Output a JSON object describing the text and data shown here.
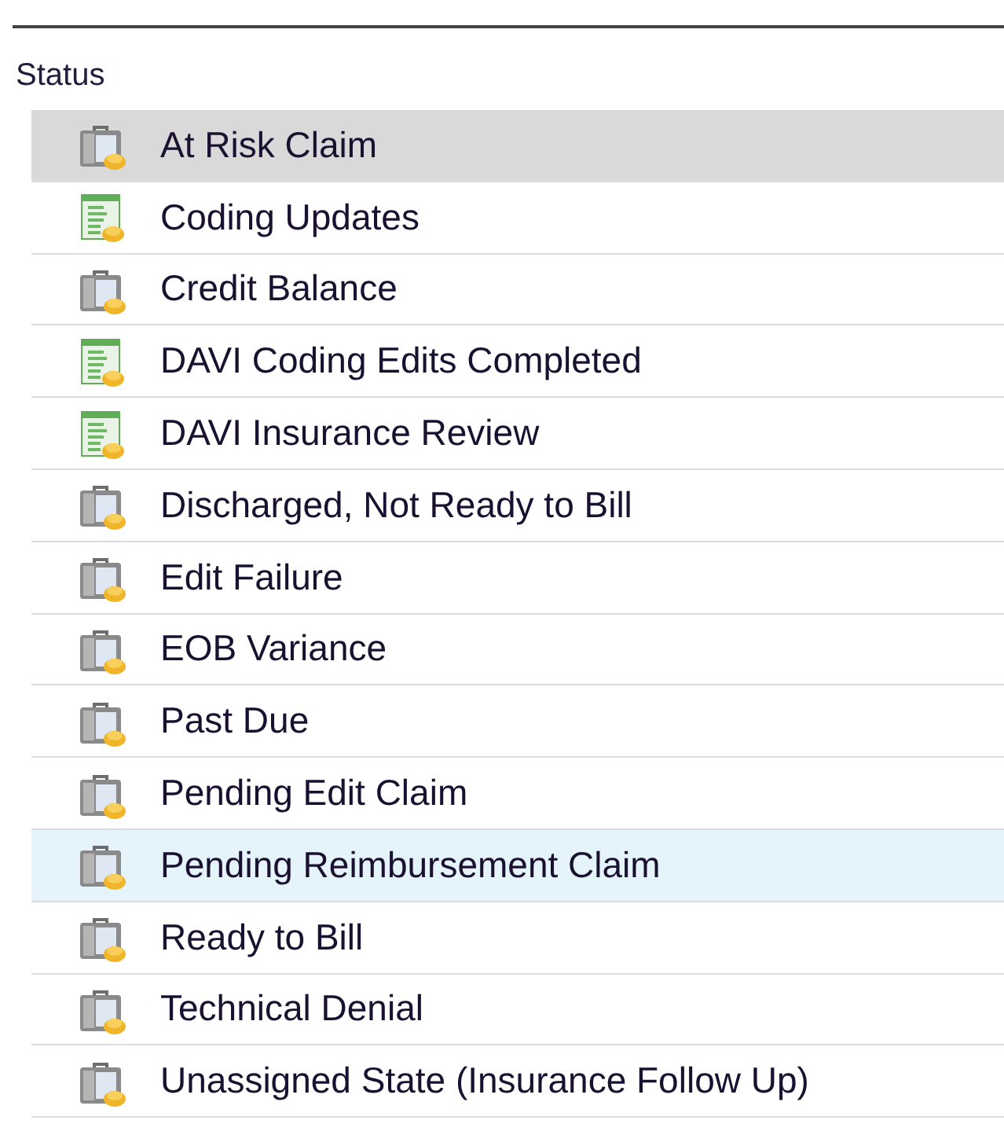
{
  "list": {
    "column_header": "Status",
    "rows": [
      {
        "label": "At Risk Claim",
        "kind": "folder",
        "selected": true,
        "hovered": false
      },
      {
        "label": "Coding Updates",
        "kind": "sheet",
        "selected": false,
        "hovered": false
      },
      {
        "label": "Credit Balance",
        "kind": "folder",
        "selected": false,
        "hovered": false
      },
      {
        "label": "DAVI Coding Edits Completed",
        "kind": "sheet",
        "selected": false,
        "hovered": false
      },
      {
        "label": "DAVI Insurance Review",
        "kind": "sheet",
        "selected": false,
        "hovered": false
      },
      {
        "label": "Discharged, Not Ready to Bill",
        "kind": "folder",
        "selected": false,
        "hovered": false
      },
      {
        "label": "Edit Failure",
        "kind": "folder",
        "selected": false,
        "hovered": false
      },
      {
        "label": "EOB Variance",
        "kind": "folder",
        "selected": false,
        "hovered": false
      },
      {
        "label": "Past Due",
        "kind": "folder",
        "selected": false,
        "hovered": false
      },
      {
        "label": "Pending Edit Claim",
        "kind": "folder",
        "selected": false,
        "hovered": false
      },
      {
        "label": "Pending Reimbursement Claim",
        "kind": "folder",
        "selected": false,
        "hovered": true
      },
      {
        "label": "Ready to Bill",
        "kind": "folder",
        "selected": false,
        "hovered": false
      },
      {
        "label": "Technical Denial",
        "kind": "folder",
        "selected": false,
        "hovered": false
      },
      {
        "label": "Unassigned State (Insurance Follow Up)",
        "kind": "folder",
        "selected": false,
        "hovered": false
      }
    ]
  }
}
